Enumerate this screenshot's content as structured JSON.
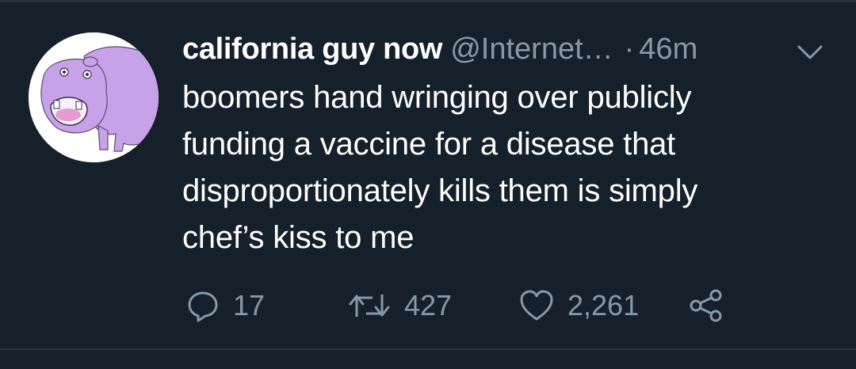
{
  "tweet": {
    "author": {
      "display_name": "california guy now",
      "handle": "@Internet…",
      "avatar_icon": "purple-hippo-avatar"
    },
    "separator": "·",
    "timestamp": "46m",
    "text_lines": [
      "boomers hand wringing over publicly",
      "funding a vaccine for a disease that",
      "disproportionately kills them is simply",
      "chef’s kiss to me"
    ],
    "actions": {
      "reply": {
        "icon": "reply-icon",
        "count": "17"
      },
      "retweet": {
        "icon": "retweet-icon",
        "count": "427"
      },
      "like": {
        "icon": "heart-icon",
        "count": "2,261"
      },
      "share": {
        "icon": "share-icon"
      }
    },
    "menu_icon": "chevron-down-icon"
  },
  "colors": {
    "background": "#15202b",
    "primary_text": "#ffffff",
    "secondary_text": "#8899a6",
    "divider": "#253341",
    "avatar_hippo": "#c8a2e8"
  }
}
